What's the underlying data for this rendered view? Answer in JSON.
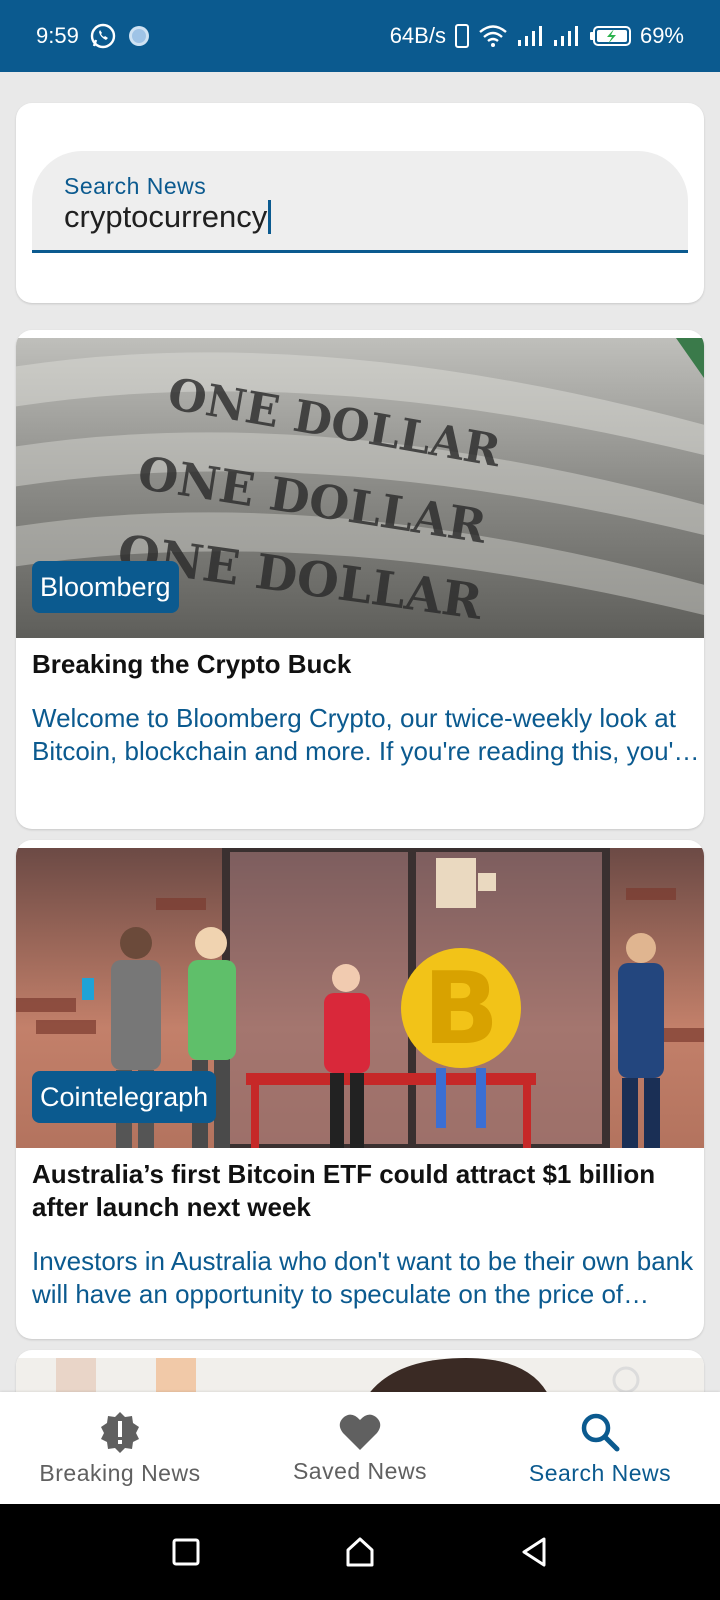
{
  "status_bar": {
    "time": "9:59",
    "network_speed": "64B/s",
    "battery": "69%",
    "icons": [
      "whatsapp-icon",
      "notification-dot-icon",
      "phone-icon",
      "wifi-icon",
      "signal-icon",
      "signal-icon",
      "battery-charging-icon"
    ]
  },
  "search": {
    "label": "Search News",
    "value": "cryptocurrency"
  },
  "articles": [
    {
      "source": "Bloomberg",
      "title": "Breaking the Crypto Buck",
      "description": "Welcome to Bloomberg Crypto, our twice-weekly look at Bitcoin, blockchain and more. If you're reading this, you're probably curious about what happens next.",
      "image": "dollar-bills-image"
    },
    {
      "source": "Cointelegraph",
      "title": "Australia’s first Bitcoin ETF could attract $1 billion after launch next week",
      "description": "Investors in Australia who don't want to be their own bank will have an opportunity to speculate on the price of Bitcoin.",
      "image": "bitcoin-bus-stop-illustration"
    }
  ],
  "bottom_nav": {
    "items": [
      {
        "label": "Breaking News",
        "icon": "alert-badge-icon"
      },
      {
        "label": "Saved News",
        "icon": "heart-icon"
      },
      {
        "label": "Search News",
        "icon": "search-icon",
        "active": true
      }
    ]
  },
  "colors": {
    "primary": "#0b5a8f",
    "background": "#e9e9e9",
    "card": "#ffffff"
  }
}
